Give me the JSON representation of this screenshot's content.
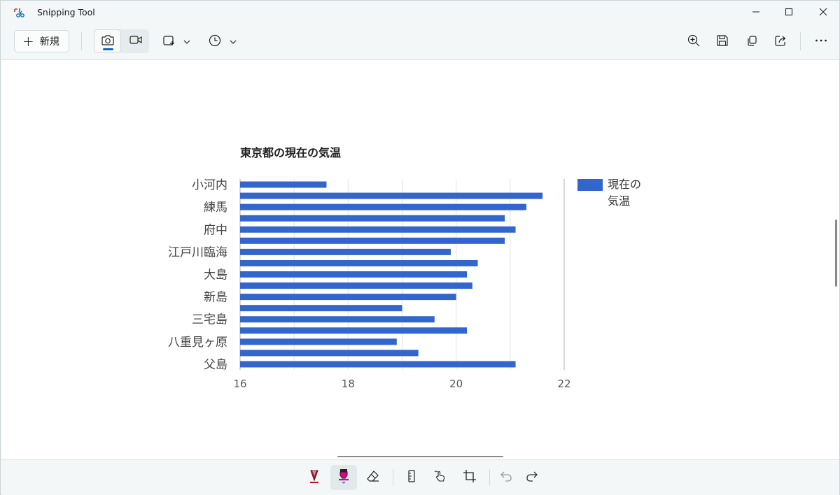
{
  "window": {
    "title": "Snipping Tool"
  },
  "toolbar": {
    "new_label": "新規",
    "icons": [
      "camera-icon",
      "video-icon",
      "snip-mode-icon",
      "chevron-down-icon",
      "timer-icon",
      "chevron-down-icon",
      "zoom-in-icon",
      "save-icon",
      "copy-icon",
      "share-icon",
      "more-icon"
    ]
  },
  "chart_data": {
    "type": "bar",
    "orientation": "horizontal",
    "title": "東京都の現在の気温",
    "category_labels": [
      "小河内",
      "練馬",
      "府中",
      "江戸川臨海",
      "大島",
      "新島",
      "三宅島",
      "八重見ヶ原",
      "父島"
    ],
    "series": [
      {
        "name": "現在の気温",
        "color": "#3366cc",
        "values": [
          17.6,
          21.6,
          21.3,
          20.9,
          21.1,
          20.9,
          19.9,
          20.4,
          20.2,
          20.3,
          20.0,
          19.0,
          19.6,
          20.2,
          18.9,
          19.3,
          21.1
        ]
      }
    ],
    "xlim": [
      16,
      22
    ],
    "x_ticks": [
      "16",
      "18",
      "20",
      "22"
    ],
    "grid": true,
    "legend_position": "right"
  },
  "bottombar": {
    "icons": [
      "ballpoint-pen-icon",
      "highlighter-icon",
      "eraser-icon",
      "ruler-icon",
      "touch-writing-icon",
      "crop-icon",
      "undo-icon",
      "redo-icon"
    ]
  }
}
